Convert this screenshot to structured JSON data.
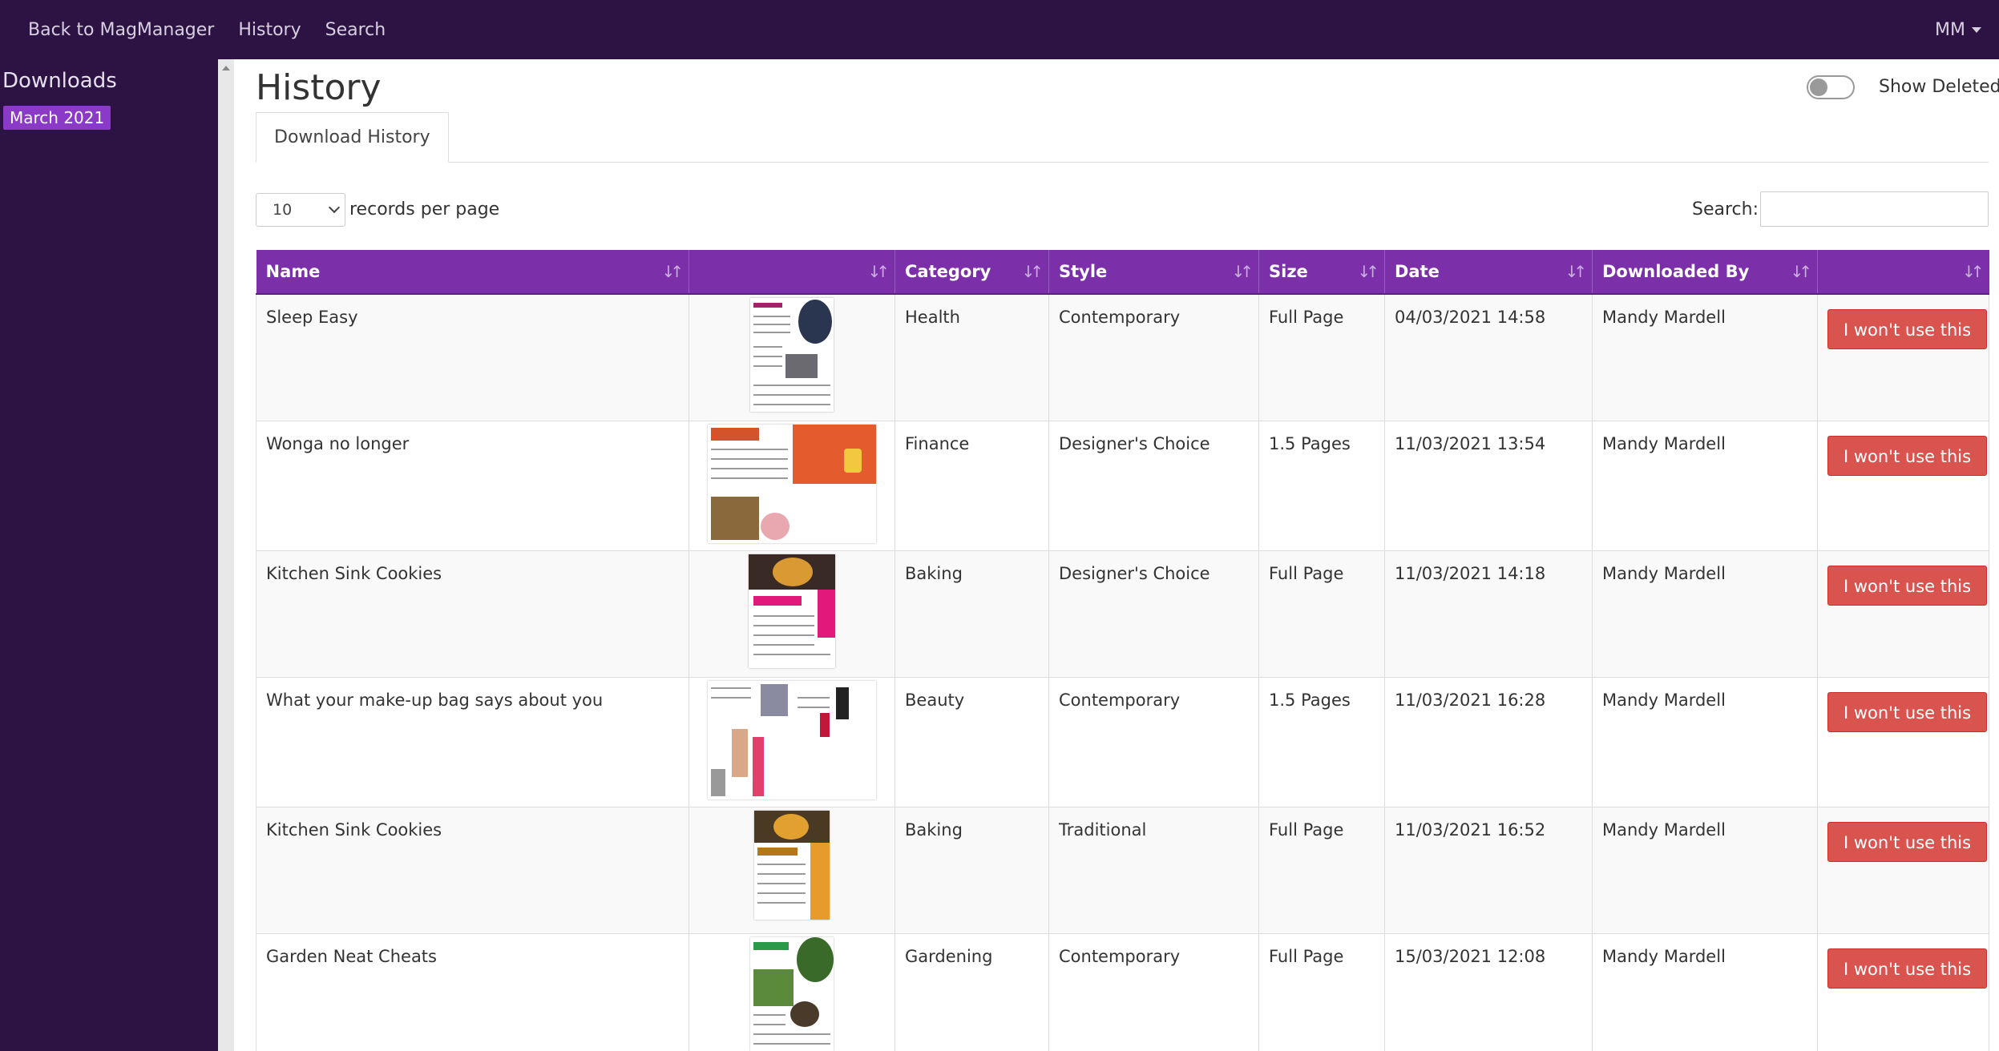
{
  "navbar": {
    "links": [
      "Back to MagManager",
      "History",
      "Search"
    ],
    "user_initials": "MM"
  },
  "sidebar": {
    "title": "Downloads",
    "badge": "March 2021"
  },
  "page": {
    "title": "History",
    "show_deleted_label": "Show Deleted",
    "tab_label": "Download History"
  },
  "controls": {
    "records_per_page_value": "10",
    "records_per_page_label": "records per page",
    "search_label": "Search:",
    "search_value": ""
  },
  "table": {
    "columns": [
      "Name",
      "",
      "Category",
      "Style",
      "Size",
      "Date",
      "Downloaded By",
      ""
    ],
    "rows": [
      {
        "name": "Sleep Easy",
        "category": "Health",
        "style": "Contemporary",
        "size": "Full Page",
        "date": "04/03/2021 14:58",
        "downloaded_by": "Mandy Mardell",
        "action": "I won't use this"
      },
      {
        "name": "Wonga no longer",
        "category": "Finance",
        "style": "Designer's Choice",
        "size": "1.5 Pages",
        "date": "11/03/2021 13:54",
        "downloaded_by": "Mandy Mardell",
        "action": "I won't use this"
      },
      {
        "name": "Kitchen Sink Cookies",
        "category": "Baking",
        "style": "Designer's Choice",
        "size": "Full Page",
        "date": "11/03/2021 14:18",
        "downloaded_by": "Mandy Mardell",
        "action": "I won't use this"
      },
      {
        "name": "What your make-up bag says about you",
        "category": "Beauty",
        "style": "Contemporary",
        "size": "1.5 Pages",
        "date": "11/03/2021 16:28",
        "downloaded_by": "Mandy Mardell",
        "action": "I won't use this"
      },
      {
        "name": "Kitchen Sink Cookies",
        "category": "Baking",
        "style": "Traditional",
        "size": "Full Page",
        "date": "11/03/2021 16:52",
        "downloaded_by": "Mandy Mardell",
        "action": "I won't use this"
      },
      {
        "name": "Garden Neat Cheats",
        "category": "Gardening",
        "style": "Contemporary",
        "size": "Full Page",
        "date": "15/03/2021 12:08",
        "downloaded_by": "Mandy Mardell",
        "action": "I won't use this"
      }
    ]
  },
  "colors": {
    "nav_bg": "#2d1244",
    "header_bg": "#7b2fa8",
    "badge_bg": "#8a3ac6",
    "danger": "#d9534f"
  },
  "icons": {
    "sort": "sort-icon",
    "dropdown": "caret-down-icon",
    "thumbnail": "article-thumbnail"
  }
}
